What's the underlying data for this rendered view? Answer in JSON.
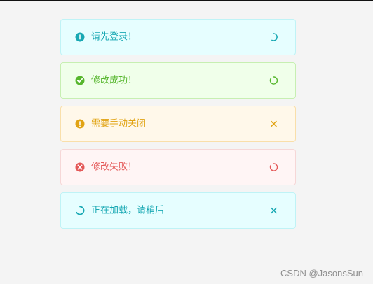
{
  "alerts": [
    {
      "type": "info",
      "message": "请先登录！",
      "icon": "info-icon",
      "action": "loading-spinner"
    },
    {
      "type": "success",
      "message": "修改成功！",
      "icon": "check-circle-icon",
      "action": "loading-spinner"
    },
    {
      "type": "warning",
      "message": "需要手动关闭",
      "icon": "warning-icon",
      "action": "close-icon"
    },
    {
      "type": "error",
      "message": "修改失败！",
      "icon": "error-icon",
      "action": "loading-spinner"
    },
    {
      "type": "loading",
      "message": "正在加载，请稍后",
      "icon": "loading-icon",
      "action": "close-icon"
    }
  ],
  "watermark": "CSDN @JasonsSun"
}
